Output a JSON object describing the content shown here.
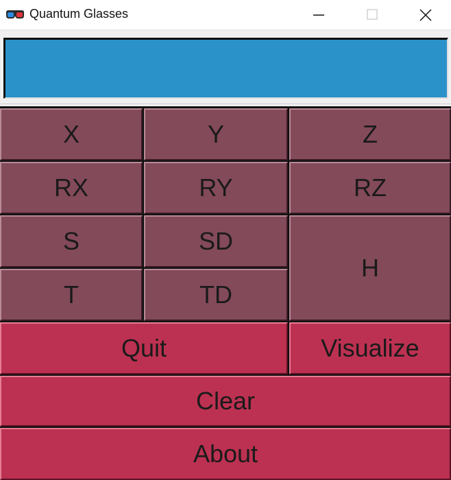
{
  "window": {
    "title": "Quantum Glasses",
    "icon": "3d-glasses-icon",
    "controls": [
      "minimize-icon",
      "maximize-icon",
      "close-icon"
    ]
  },
  "display": {
    "value": ""
  },
  "gates": {
    "x": "X",
    "y": "Y",
    "z": "Z",
    "rx": "RX",
    "ry": "RY",
    "rz": "RZ",
    "s": "S",
    "sd": "SD",
    "h": "H",
    "t": "T",
    "td": "TD"
  },
  "actions": {
    "quit": "Quit",
    "visualize": "Visualize",
    "clear": "Clear",
    "about": "About"
  },
  "colors": {
    "display_bg": "#2a92c9",
    "gate_button": "#834a5a",
    "action_button": "#bc3151"
  }
}
